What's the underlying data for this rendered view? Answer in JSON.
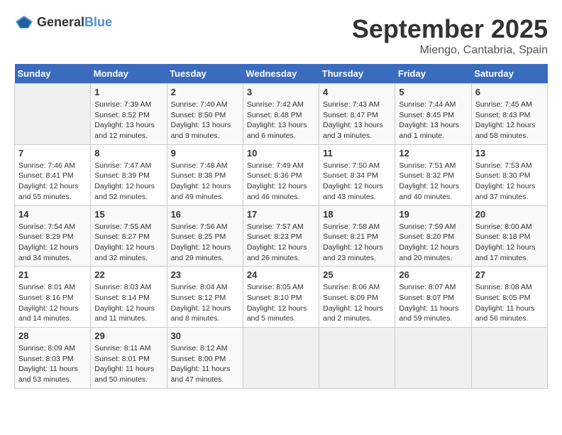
{
  "header": {
    "logo_general": "General",
    "logo_blue": "Blue",
    "month": "September 2025",
    "location": "Miengo, Cantabria, Spain"
  },
  "weekdays": [
    "Sunday",
    "Monday",
    "Tuesday",
    "Wednesday",
    "Thursday",
    "Friday",
    "Saturday"
  ],
  "weeks": [
    [
      {
        "day": "",
        "sunrise": "",
        "sunset": "",
        "daylight": ""
      },
      {
        "day": "1",
        "sunrise": "Sunrise: 7:39 AM",
        "sunset": "Sunset: 8:52 PM",
        "daylight": "Daylight: 13 hours and 12 minutes."
      },
      {
        "day": "2",
        "sunrise": "Sunrise: 7:40 AM",
        "sunset": "Sunset: 8:50 PM",
        "daylight": "Daylight: 13 hours and 9 minutes."
      },
      {
        "day": "3",
        "sunrise": "Sunrise: 7:42 AM",
        "sunset": "Sunset: 8:48 PM",
        "daylight": "Daylight: 13 hours and 6 minutes."
      },
      {
        "day": "4",
        "sunrise": "Sunrise: 7:43 AM",
        "sunset": "Sunset: 8:47 PM",
        "daylight": "Daylight: 13 hours and 3 minutes."
      },
      {
        "day": "5",
        "sunrise": "Sunrise: 7:44 AM",
        "sunset": "Sunset: 8:45 PM",
        "daylight": "Daylight: 13 hours and 1 minute."
      },
      {
        "day": "6",
        "sunrise": "Sunrise: 7:45 AM",
        "sunset": "Sunset: 8:43 PM",
        "daylight": "Daylight: 12 hours and 58 minutes."
      }
    ],
    [
      {
        "day": "7",
        "sunrise": "Sunrise: 7:46 AM",
        "sunset": "Sunset: 8:41 PM",
        "daylight": "Daylight: 12 hours and 55 minutes."
      },
      {
        "day": "8",
        "sunrise": "Sunrise: 7:47 AM",
        "sunset": "Sunset: 8:39 PM",
        "daylight": "Daylight: 12 hours and 52 minutes."
      },
      {
        "day": "9",
        "sunrise": "Sunrise: 7:48 AM",
        "sunset": "Sunset: 8:38 PM",
        "daylight": "Daylight: 12 hours and 49 minutes."
      },
      {
        "day": "10",
        "sunrise": "Sunrise: 7:49 AM",
        "sunset": "Sunset: 8:36 PM",
        "daylight": "Daylight: 12 hours and 46 minutes."
      },
      {
        "day": "11",
        "sunrise": "Sunrise: 7:50 AM",
        "sunset": "Sunset: 8:34 PM",
        "daylight": "Daylight: 12 hours and 43 minutes."
      },
      {
        "day": "12",
        "sunrise": "Sunrise: 7:51 AM",
        "sunset": "Sunset: 8:32 PM",
        "daylight": "Daylight: 12 hours and 40 minutes."
      },
      {
        "day": "13",
        "sunrise": "Sunrise: 7:53 AM",
        "sunset": "Sunset: 8:30 PM",
        "daylight": "Daylight: 12 hours and 37 minutes."
      }
    ],
    [
      {
        "day": "14",
        "sunrise": "Sunrise: 7:54 AM",
        "sunset": "Sunset: 8:29 PM",
        "daylight": "Daylight: 12 hours and 34 minutes."
      },
      {
        "day": "15",
        "sunrise": "Sunrise: 7:55 AM",
        "sunset": "Sunset: 8:27 PM",
        "daylight": "Daylight: 12 hours and 32 minutes."
      },
      {
        "day": "16",
        "sunrise": "Sunrise: 7:56 AM",
        "sunset": "Sunset: 8:25 PM",
        "daylight": "Daylight: 12 hours and 29 minutes."
      },
      {
        "day": "17",
        "sunrise": "Sunrise: 7:57 AM",
        "sunset": "Sunset: 8:23 PM",
        "daylight": "Daylight: 12 hours and 26 minutes."
      },
      {
        "day": "18",
        "sunrise": "Sunrise: 7:58 AM",
        "sunset": "Sunset: 8:21 PM",
        "daylight": "Daylight: 12 hours and 23 minutes."
      },
      {
        "day": "19",
        "sunrise": "Sunrise: 7:59 AM",
        "sunset": "Sunset: 8:20 PM",
        "daylight": "Daylight: 12 hours and 20 minutes."
      },
      {
        "day": "20",
        "sunrise": "Sunrise: 8:00 AM",
        "sunset": "Sunset: 8:18 PM",
        "daylight": "Daylight: 12 hours and 17 minutes."
      }
    ],
    [
      {
        "day": "21",
        "sunrise": "Sunrise: 8:01 AM",
        "sunset": "Sunset: 8:16 PM",
        "daylight": "Daylight: 12 hours and 14 minutes."
      },
      {
        "day": "22",
        "sunrise": "Sunrise: 8:03 AM",
        "sunset": "Sunset: 8:14 PM",
        "daylight": "Daylight: 12 hours and 11 minutes."
      },
      {
        "day": "23",
        "sunrise": "Sunrise: 8:04 AM",
        "sunset": "Sunset: 8:12 PM",
        "daylight": "Daylight: 12 hours and 8 minutes."
      },
      {
        "day": "24",
        "sunrise": "Sunrise: 8:05 AM",
        "sunset": "Sunset: 8:10 PM",
        "daylight": "Daylight: 12 hours and 5 minutes."
      },
      {
        "day": "25",
        "sunrise": "Sunrise: 8:06 AM",
        "sunset": "Sunset: 8:09 PM",
        "daylight": "Daylight: 12 hours and 2 minutes."
      },
      {
        "day": "26",
        "sunrise": "Sunrise: 8:07 AM",
        "sunset": "Sunset: 8:07 PM",
        "daylight": "Daylight: 11 hours and 59 minutes."
      },
      {
        "day": "27",
        "sunrise": "Sunrise: 8:08 AM",
        "sunset": "Sunset: 8:05 PM",
        "daylight": "Daylight: 11 hours and 56 minutes."
      }
    ],
    [
      {
        "day": "28",
        "sunrise": "Sunrise: 8:09 AM",
        "sunset": "Sunset: 8:03 PM",
        "daylight": "Daylight: 11 hours and 53 minutes."
      },
      {
        "day": "29",
        "sunrise": "Sunrise: 8:11 AM",
        "sunset": "Sunset: 8:01 PM",
        "daylight": "Daylight: 11 hours and 50 minutes."
      },
      {
        "day": "30",
        "sunrise": "Sunrise: 8:12 AM",
        "sunset": "Sunset: 8:00 PM",
        "daylight": "Daylight: 11 hours and 47 minutes."
      },
      {
        "day": "",
        "sunrise": "",
        "sunset": "",
        "daylight": ""
      },
      {
        "day": "",
        "sunrise": "",
        "sunset": "",
        "daylight": ""
      },
      {
        "day": "",
        "sunrise": "",
        "sunset": "",
        "daylight": ""
      },
      {
        "day": "",
        "sunrise": "",
        "sunset": "",
        "daylight": ""
      }
    ]
  ]
}
